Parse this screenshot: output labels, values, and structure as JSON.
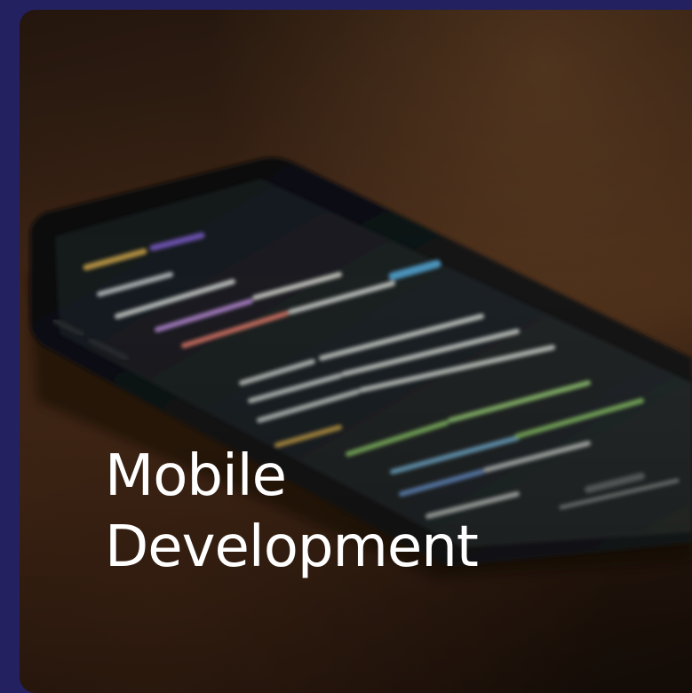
{
  "card": {
    "title_line_1": "Mobile",
    "title_line_2": "Development",
    "image_subject": "smartphone-with-code-photo"
  },
  "colors": {
    "page_background": "#23215f",
    "title_text": "#ffffff"
  }
}
